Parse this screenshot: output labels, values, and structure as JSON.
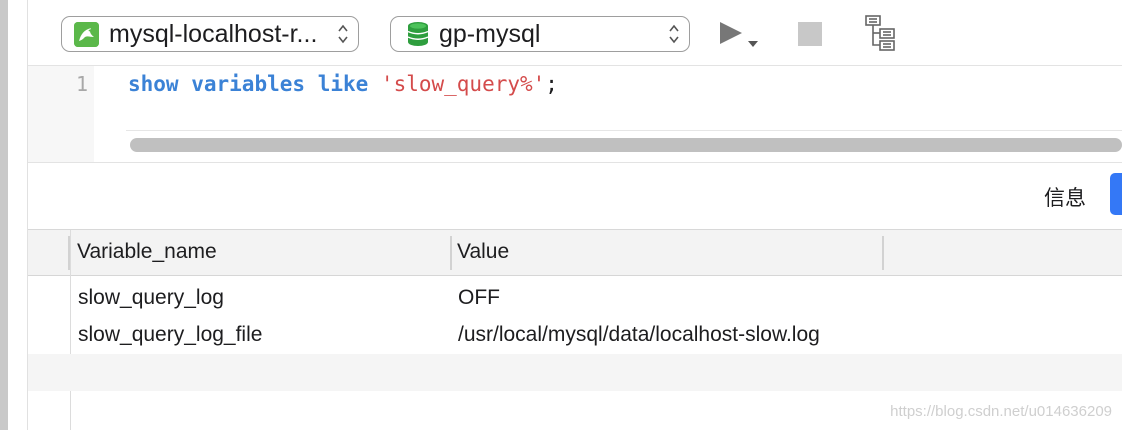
{
  "toolbar": {
    "connection": {
      "label": "mysql-localhost-r...",
      "icon": "mysql-dolphin-icon",
      "icon_color": "#5bb84a"
    },
    "database": {
      "label": "gp-mysql",
      "icon": "database-icon",
      "icon_color": "#2e9e3e"
    },
    "run_icon": "play-icon",
    "stop_icon": "stop-icon",
    "explain_icon": "query-plan-icon"
  },
  "editor": {
    "line_numbers": [
      "1"
    ],
    "code": {
      "kw1": "show",
      "kw2": "variables",
      "kw3": "like",
      "literal": "'slow_query%'",
      "terminator": ";"
    },
    "colors": {
      "keyword": "#3b82d6",
      "string": "#d44b4b"
    }
  },
  "result": {
    "tabs": {
      "info": "信息"
    },
    "accent": "#3478f6",
    "columns": [
      "Variable_name",
      "Value"
    ],
    "rows": [
      [
        "slow_query_log",
        "OFF"
      ],
      [
        "slow_query_log_file",
        "/usr/local/mysql/data/localhost-slow.log"
      ]
    ]
  },
  "watermark": "https://blog.csdn.net/u014636209"
}
